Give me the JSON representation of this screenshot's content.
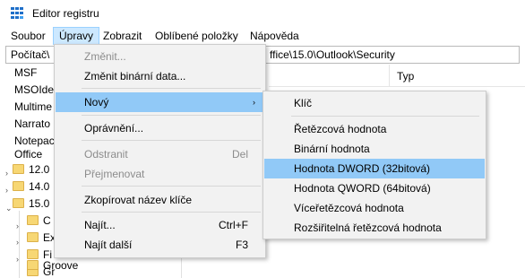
{
  "window": {
    "title": "Editor registru"
  },
  "menubar": {
    "items": [
      {
        "label": "Soubor"
      },
      {
        "label": "Úpravy"
      },
      {
        "label": "Zobrazit"
      },
      {
        "label": "Oblíbené položky"
      },
      {
        "label": "Nápověda"
      }
    ],
    "active_index": 1
  },
  "address": {
    "left_text": "Počítač\\",
    "right_text": "ffice\\15.0\\Outlook\\Security"
  },
  "tree": {
    "items": [
      {
        "label": "MSF"
      },
      {
        "label": "MSOIde"
      },
      {
        "label": "Multime"
      },
      {
        "label": "Narrato"
      },
      {
        "label": "Notepac"
      },
      {
        "label": "Office"
      },
      {
        "label": "12.0"
      },
      {
        "label": "14.0"
      },
      {
        "label": "15.0"
      },
      {
        "label": "C"
      },
      {
        "label": "Ex"
      },
      {
        "label": "Fi"
      },
      {
        "label": "Gr"
      },
      {
        "label": "Groove"
      }
    ]
  },
  "list_header": {
    "type_col": "Typ"
  },
  "edit_menu": {
    "items": [
      {
        "label": "Změnit...",
        "disabled": true
      },
      {
        "label": "Změnit binární data...",
        "disabled": false
      },
      {
        "label": "Nový",
        "has_submenu": true,
        "highlighted": true
      },
      {
        "label": "Oprávnění...",
        "disabled": false
      },
      {
        "label": "Odstranit",
        "shortcut": "Del",
        "disabled": true
      },
      {
        "label": "Přejmenovat",
        "disabled": true
      },
      {
        "label": "Zkopírovat název klíče",
        "disabled": false
      },
      {
        "label": "Najít...",
        "shortcut": "Ctrl+F",
        "disabled": false
      },
      {
        "label": "Najít další",
        "shortcut": "F3",
        "disabled": false
      }
    ]
  },
  "new_submenu": {
    "items": [
      {
        "label": "Klíč"
      },
      {
        "label": "Řetězcová hodnota"
      },
      {
        "label": "Binární hodnota"
      },
      {
        "label": "Hodnota DWORD (32bitová)",
        "highlighted": true
      },
      {
        "label": "Hodnota QWORD (64bitová)"
      },
      {
        "label": "Víceřetězcová hodnota"
      },
      {
        "label": "Rozšiřitelná řetězcová hodnota"
      }
    ]
  },
  "colors": {
    "menu_background": "#f2f2f2",
    "highlight": "#91c9f7",
    "active_menu": "#cce8ff",
    "folder": "#f7d774",
    "app_icon": "#1f6fc9"
  }
}
